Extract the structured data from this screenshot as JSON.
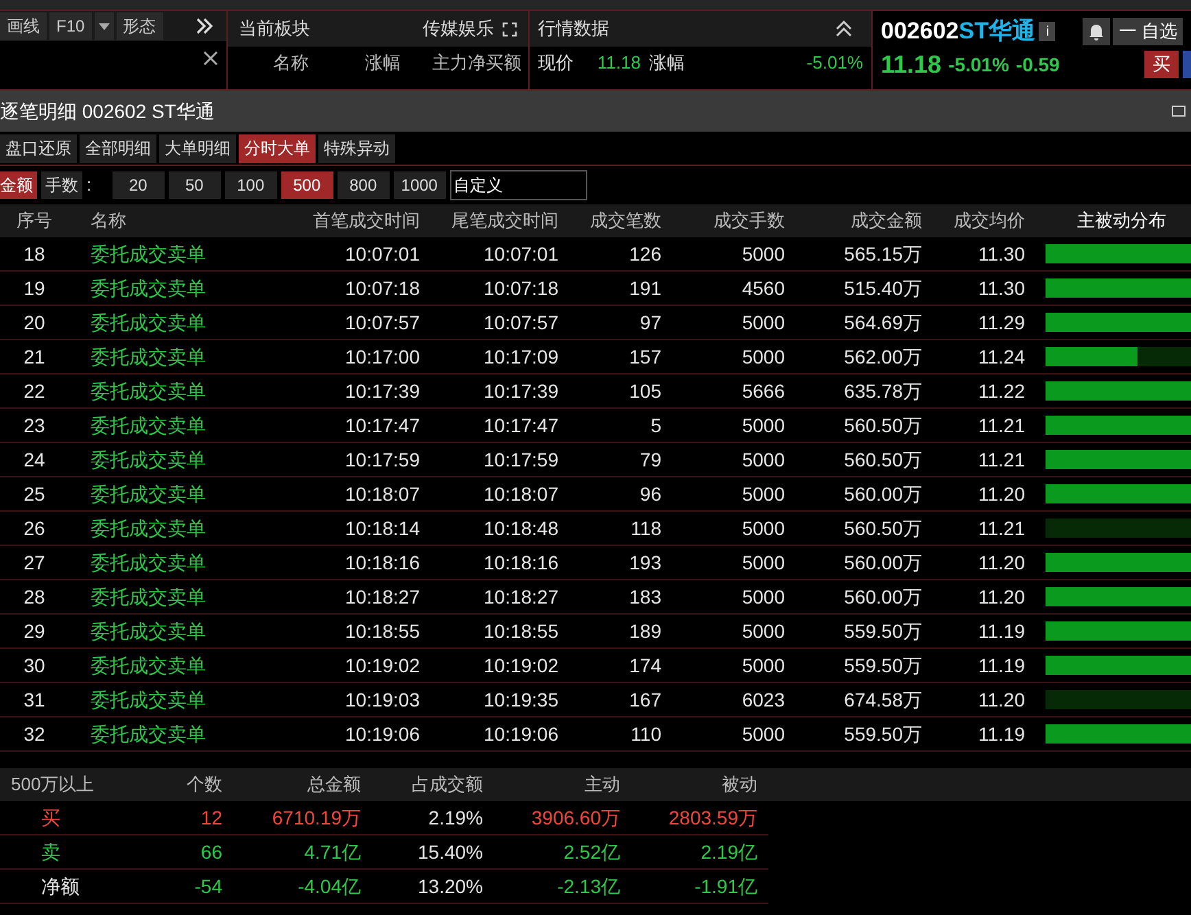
{
  "toolbar": {
    "buttons": [
      {
        "label": "画线",
        "kind": "text"
      },
      {
        "label": "F10",
        "kind": "text"
      },
      {
        "kind": "caret"
      },
      {
        "label": "形态",
        "kind": "text"
      }
    ]
  },
  "sector_panel": {
    "title": "当前板块",
    "sector": "传媒娱乐",
    "columns": [
      "名称",
      "涨幅",
      "主力净买额"
    ]
  },
  "quote_panel": {
    "title": "行情数据",
    "rows": [
      {
        "label": "现价",
        "value": "11.18",
        "label2": "涨幅",
        "value2": "-5.01%"
      }
    ]
  },
  "stock_header": {
    "code": "002602",
    "name": "ST华通",
    "info": "i",
    "watch_button": "一 自选",
    "price": "11.18",
    "change_pct": "-5.01%",
    "change": "-0.59",
    "buy_button": "买"
  },
  "window": {
    "title": "逐笔明细 002602 ST华通"
  },
  "tabs": [
    {
      "label": "盘口还原",
      "selected": false
    },
    {
      "label": "全部明细",
      "selected": false
    },
    {
      "label": "大单明细",
      "selected": false
    },
    {
      "label": "分时大单",
      "selected": true
    },
    {
      "label": "特殊异动",
      "selected": false
    }
  ],
  "filter": {
    "modes": [
      {
        "label": "金额",
        "selected": true
      },
      {
        "label": "手数",
        "selected": false
      }
    ],
    "separator": ":",
    "sizes": [
      {
        "label": "20",
        "selected": false
      },
      {
        "label": "50",
        "selected": false
      },
      {
        "label": "100",
        "selected": false
      },
      {
        "label": "500",
        "selected": true
      },
      {
        "label": "800",
        "selected": false
      },
      {
        "label": "1000",
        "selected": false
      }
    ],
    "custom_value": "自定义"
  },
  "table": {
    "columns": [
      "序号",
      "名称",
      "首笔成交时间",
      "尾笔成交时间",
      "成交笔数",
      "成交手数",
      "成交金额",
      "成交均价",
      "主被动分布"
    ],
    "rows": [
      {
        "no": "18",
        "name": "委托成交卖单",
        "first": "10:07:01",
        "last": "10:07:01",
        "count": "126",
        "lots": "5000",
        "amount": "565.15万",
        "avg": "11.30",
        "level": 1
      },
      {
        "no": "19",
        "name": "委托成交卖单",
        "first": "10:07:18",
        "last": "10:07:18",
        "count": "191",
        "lots": "4560",
        "amount": "515.40万",
        "avg": "11.30",
        "level": 1
      },
      {
        "no": "20",
        "name": "委托成交卖单",
        "first": "10:07:57",
        "last": "10:07:57",
        "count": "97",
        "lots": "5000",
        "amount": "564.69万",
        "avg": "11.29",
        "level": 1
      },
      {
        "no": "21",
        "name": "委托成交卖单",
        "first": "10:17:00",
        "last": "10:17:09",
        "count": "157",
        "lots": "5000",
        "amount": "562.00万",
        "avg": "11.24",
        "level": 0.63
      },
      {
        "no": "22",
        "name": "委托成交卖单",
        "first": "10:17:39",
        "last": "10:17:39",
        "count": "105",
        "lots": "5666",
        "amount": "635.78万",
        "avg": "11.22",
        "level": 1
      },
      {
        "no": "23",
        "name": "委托成交卖单",
        "first": "10:17:47",
        "last": "10:17:47",
        "count": "5",
        "lots": "5000",
        "amount": "560.50万",
        "avg": "11.21",
        "level": 1
      },
      {
        "no": "24",
        "name": "委托成交卖单",
        "first": "10:17:59",
        "last": "10:17:59",
        "count": "79",
        "lots": "5000",
        "amount": "560.50万",
        "avg": "11.21",
        "level": 1
      },
      {
        "no": "25",
        "name": "委托成交卖单",
        "first": "10:18:07",
        "last": "10:18:07",
        "count": "96",
        "lots": "5000",
        "amount": "560.00万",
        "avg": "11.20",
        "level": 1
      },
      {
        "no": "26",
        "name": "委托成交卖单",
        "first": "10:18:14",
        "last": "10:18:48",
        "count": "118",
        "lots": "5000",
        "amount": "560.50万",
        "avg": "11.21",
        "level": 0
      },
      {
        "no": "27",
        "name": "委托成交卖单",
        "first": "10:18:16",
        "last": "10:18:16",
        "count": "193",
        "lots": "5000",
        "amount": "560.00万",
        "avg": "11.20",
        "level": 1
      },
      {
        "no": "28",
        "name": "委托成交卖单",
        "first": "10:18:27",
        "last": "10:18:27",
        "count": "183",
        "lots": "5000",
        "amount": "560.00万",
        "avg": "11.20",
        "level": 1
      },
      {
        "no": "29",
        "name": "委托成交卖单",
        "first": "10:18:55",
        "last": "10:18:55",
        "count": "189",
        "lots": "5000",
        "amount": "559.50万",
        "avg": "11.19",
        "level": 1
      },
      {
        "no": "30",
        "name": "委托成交卖单",
        "first": "10:19:02",
        "last": "10:19:02",
        "count": "174",
        "lots": "5000",
        "amount": "559.50万",
        "avg": "11.19",
        "level": 1
      },
      {
        "no": "31",
        "name": "委托成交卖单",
        "first": "10:19:03",
        "last": "10:19:35",
        "count": "167",
        "lots": "6023",
        "amount": "674.58万",
        "avg": "11.20",
        "level": 0
      },
      {
        "no": "32",
        "name": "委托成交卖单",
        "first": "10:19:06",
        "last": "10:19:06",
        "count": "110",
        "lots": "5000",
        "amount": "559.50万",
        "avg": "11.19",
        "level": 1
      }
    ]
  },
  "summary": {
    "columns": [
      "500万以上",
      "个数",
      "总金额",
      "占成交额",
      "主动",
      "被动"
    ],
    "rows": [
      {
        "cells": [
          {
            "text": "买",
            "color": "#f0463c"
          },
          {
            "text": "12",
            "color": "#f0463c"
          },
          {
            "text": "6710.19万",
            "color": "#f0463c"
          },
          {
            "text": "2.19%",
            "color": "#e6e6e6"
          },
          {
            "text": "3906.60万",
            "color": "#f0463c"
          },
          {
            "text": "2803.59万",
            "color": "#f0463c"
          }
        ]
      },
      {
        "cells": [
          {
            "text": "卖",
            "color": "#2ec84b"
          },
          {
            "text": "66",
            "color": "#2ec84b"
          },
          {
            "text": "4.71亿",
            "color": "#2ec84b"
          },
          {
            "text": "15.40%",
            "color": "#e6e6e6"
          },
          {
            "text": "2.52亿",
            "color": "#2ec84b"
          },
          {
            "text": "2.19亿",
            "color": "#2ec84b"
          }
        ]
      },
      {
        "cells": [
          {
            "text": "净额",
            "color": "#e6e6e6"
          },
          {
            "text": "-54",
            "color": "#2ec84b"
          },
          {
            "text": "-4.04亿",
            "color": "#2ec84b"
          },
          {
            "text": "13.20%",
            "color": "#e6e6e6"
          },
          {
            "text": "-2.13亿",
            "color": "#2ec84b"
          },
          {
            "text": "-1.91亿",
            "color": "#2ec84b"
          }
        ]
      }
    ]
  }
}
